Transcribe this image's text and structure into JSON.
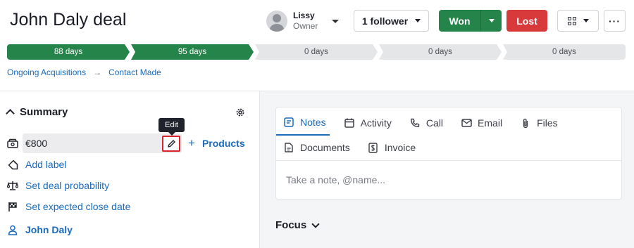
{
  "deal": {
    "title": "John Daly deal"
  },
  "owner": {
    "name": "Lissy",
    "role": "Owner"
  },
  "toolbar": {
    "follower_label": "1 follower",
    "won_label": "Won",
    "lost_label": "Lost",
    "more_label": "···"
  },
  "pipeline": {
    "stages": [
      {
        "label": "88 days",
        "status": "done"
      },
      {
        "label": "95 days",
        "status": "done"
      },
      {
        "label": "0 days",
        "status": "todo"
      },
      {
        "label": "0 days",
        "status": "todo"
      },
      {
        "label": "0 days",
        "status": "todo"
      }
    ]
  },
  "breadcrumb": {
    "pipeline": "Ongoing Acquisitions",
    "arrow": "→",
    "stage": "Contact Made"
  },
  "summary": {
    "title": "Summary",
    "value": "€800",
    "edit_tooltip": "Edit",
    "products_label": "Products",
    "products_plus": "+",
    "add_label": "Add label",
    "probability": "Set deal probability",
    "close_date": "Set expected close date",
    "person": "John Daly"
  },
  "composer": {
    "tabs": [
      {
        "label": "Notes",
        "icon": "notes-icon",
        "active": true
      },
      {
        "label": "Activity",
        "icon": "calendar-icon",
        "active": false
      },
      {
        "label": "Call",
        "icon": "phone-icon",
        "active": false
      },
      {
        "label": "Email",
        "icon": "email-icon",
        "active": false
      },
      {
        "label": "Files",
        "icon": "paperclip-icon",
        "active": false
      },
      {
        "label": "Documents",
        "icon": "document-icon",
        "active": false
      },
      {
        "label": "Invoice",
        "icon": "invoice-icon",
        "active": false
      }
    ],
    "placeholder": "Take a note, @name..."
  },
  "focus": {
    "label": "Focus"
  },
  "colors": {
    "accent": "#1a6bbd",
    "won": "#25844a",
    "lost": "#d8393b"
  }
}
